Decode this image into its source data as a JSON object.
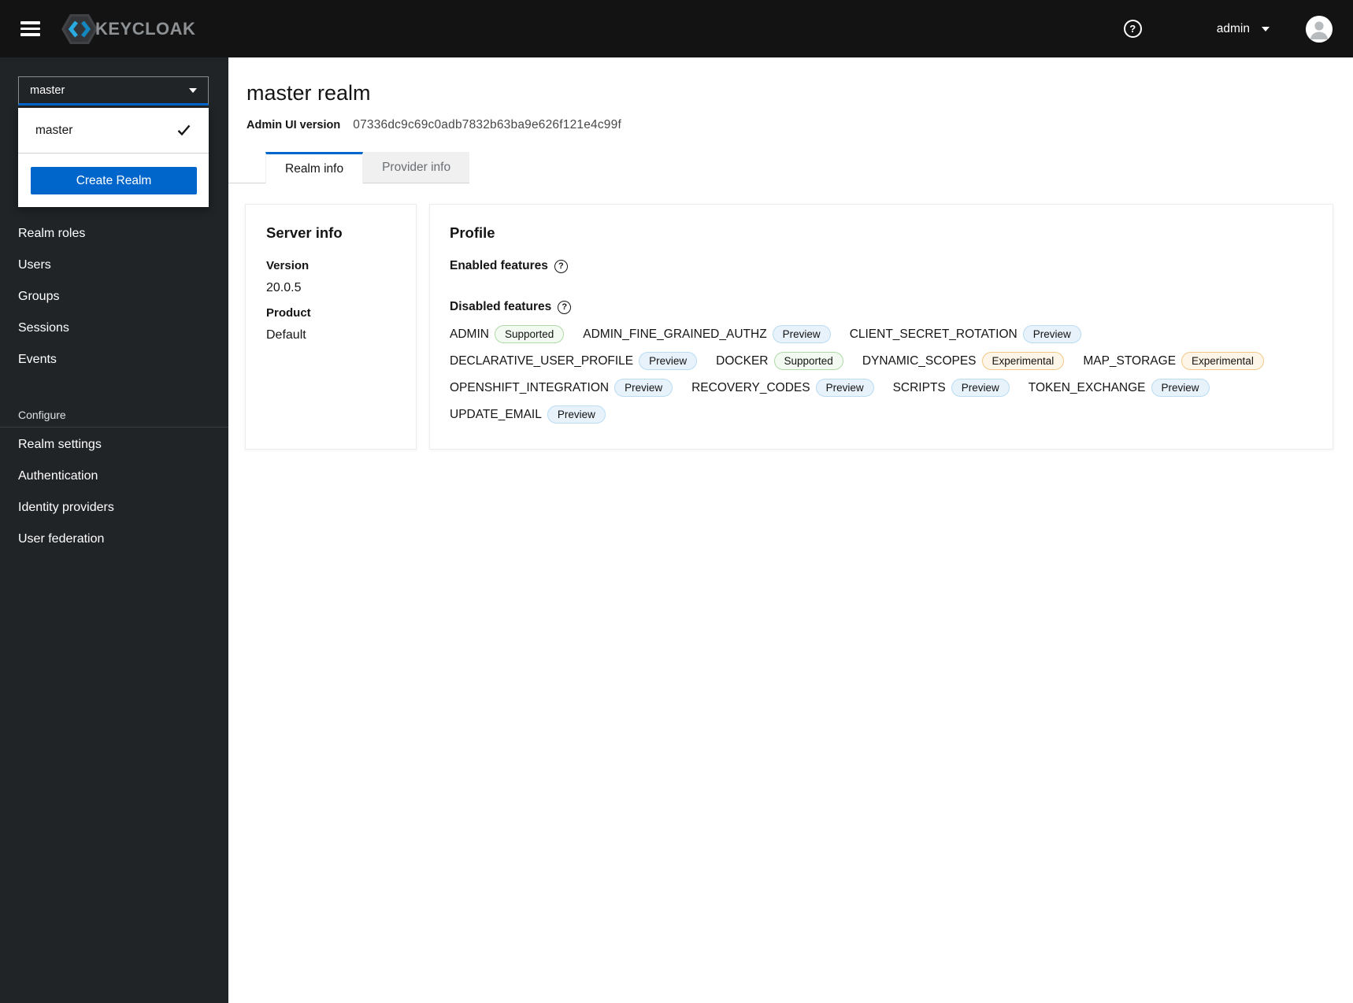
{
  "topbar": {
    "brand": "KEYCLOAK",
    "help_symbol": "?",
    "user_label": "admin"
  },
  "sidebar": {
    "realm_selector": {
      "value": "master"
    },
    "realm_dropdown": {
      "options": [
        {
          "label": "master",
          "selected": true
        }
      ],
      "create_button_label": "Create Realm"
    },
    "nav": {
      "items": [
        "Realm roles",
        "Users",
        "Groups",
        "Sessions",
        "Events"
      ],
      "configure": {
        "title": "Configure",
        "items": [
          "Realm settings",
          "Authentication",
          "Identity providers",
          "User federation"
        ]
      }
    }
  },
  "main": {
    "title": "master realm",
    "admin_ui_version_label": "Admin UI version",
    "admin_ui_version_value": "07336dc9c69c0adb7832b63ba9e626f121e4c99f",
    "tabs": [
      {
        "label": "Realm info",
        "active": true
      },
      {
        "label": "Provider info",
        "active": false
      }
    ],
    "server_info_card": {
      "title": "Server info",
      "fields": [
        {
          "label": "Version",
          "value": "20.0.5"
        },
        {
          "label": "Product",
          "value": "Default"
        }
      ]
    },
    "profile_card": {
      "title": "Profile",
      "enabled_label": "Enabled features",
      "disabled_label": "Disabled features",
      "features": [
        {
          "name": "ADMIN",
          "badge": "Supported",
          "type": "supported"
        },
        {
          "name": "ADMIN_FINE_GRAINED_AUTHZ",
          "badge": "Preview",
          "type": "preview"
        },
        {
          "name": "CLIENT_SECRET_ROTATION",
          "badge": "Preview",
          "type": "preview"
        },
        {
          "name": "DECLARATIVE_USER_PROFILE",
          "badge": "Preview",
          "type": "preview"
        },
        {
          "name": "DOCKER",
          "badge": "Supported",
          "type": "supported"
        },
        {
          "name": "DYNAMIC_SCOPES",
          "badge": "Experimental",
          "type": "experimental"
        },
        {
          "name": "MAP_STORAGE",
          "badge": "Experimental",
          "type": "experimental"
        },
        {
          "name": "OPENSHIFT_INTEGRATION",
          "badge": "Preview",
          "type": "preview"
        },
        {
          "name": "RECOVERY_CODES",
          "badge": "Preview",
          "type": "preview"
        },
        {
          "name": "SCRIPTS",
          "badge": "Preview",
          "type": "preview"
        },
        {
          "name": "TOKEN_EXCHANGE",
          "badge": "Preview",
          "type": "preview"
        },
        {
          "name": "UPDATE_EMAIL",
          "badge": "Preview",
          "type": "preview"
        }
      ]
    }
  },
  "colors": {
    "accent_blue": "#0066cc",
    "topbar_bg": "#131313",
    "sidebar_bg": "#212427",
    "badge_supported_border": "#aedaa6",
    "badge_preview_border": "#b9dcf2",
    "badge_experimental_border": "#f3c887"
  }
}
